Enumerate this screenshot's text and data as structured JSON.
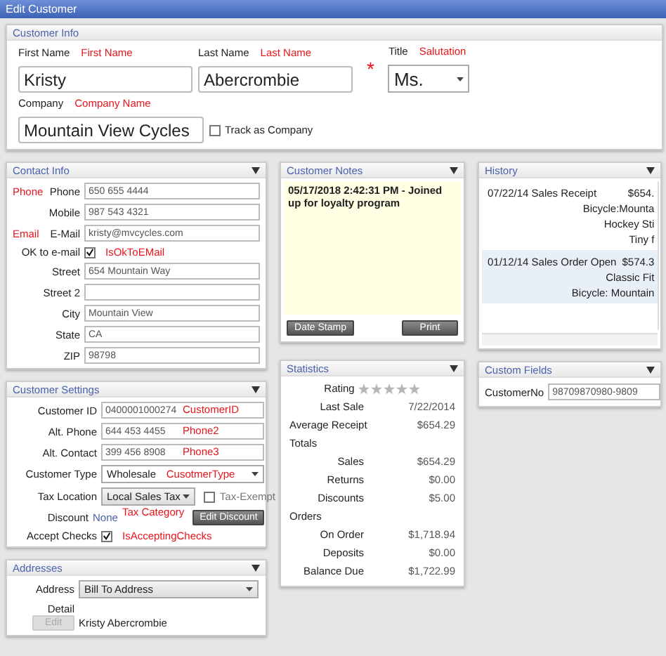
{
  "window": {
    "title": "Edit Customer"
  },
  "customer_info": {
    "title": "Customer Info",
    "first_name": {
      "label": "First Name",
      "annotation": "First Name",
      "value": "Kristy"
    },
    "last_name": {
      "label": "Last Name",
      "annotation": "Last Name",
      "value": "Abercrombie"
    },
    "required_mark": "*",
    "salutation": {
      "label": "Title",
      "annotation": "Salutation",
      "value": "Ms."
    },
    "company": {
      "label": "Company",
      "annotation": "Company Name",
      "value": "Mountain View Cycles"
    },
    "track_as_company": {
      "label": "Track as Company",
      "checked": false
    }
  },
  "contact_info": {
    "title": "Contact Info",
    "rows": [
      {
        "kind": "field",
        "label": "Phone",
        "annotation": "Phone",
        "value": "650 655 4444"
      },
      {
        "kind": "field",
        "label": "Mobile",
        "value": "987 543 4321"
      },
      {
        "kind": "field",
        "label": "E-Mail",
        "annotation": "Email",
        "value": "kristy@mvcycles.com"
      },
      {
        "kind": "checkbox",
        "label": "OK to e-mail",
        "annotation": "IsOkToEMail",
        "checked": true
      },
      {
        "kind": "field",
        "label": "Street",
        "value": "654 Mountain Way"
      },
      {
        "kind": "field",
        "label": "Street 2"
      },
      {
        "kind": "field",
        "label": "City",
        "value": "Mountain View"
      },
      {
        "kind": "field",
        "label": "State",
        "value": "CA"
      },
      {
        "kind": "field",
        "label": "ZIP",
        "value": "98798"
      }
    ]
  },
  "customer_settings": {
    "title": "Customer Settings",
    "customer_id": {
      "label": "Customer ID",
      "value": "0400001000274",
      "annotation": "CustomerID"
    },
    "alt_phone": {
      "label": "Alt. Phone",
      "value": "644 453 4455",
      "annotation": "Phone2"
    },
    "alt_contact": {
      "label": "Alt. Contact",
      "value": "399 456 8908",
      "annotation": "Phone3"
    },
    "customer_type": {
      "label": "Customer Type",
      "value": "Wholesale",
      "annotation": "CusotmerType"
    },
    "tax_location": {
      "label": "Tax Location",
      "value": "Local Sales Tax"
    },
    "tax_exempt": {
      "label": "Tax-Exempt",
      "checked": false
    },
    "discount": {
      "label": "Discount",
      "value": "None",
      "annotation": "Tax Category",
      "button": "Edit Discount"
    },
    "accept_checks": {
      "label": "Accept Checks",
      "checked": true,
      "annotation": "IsAcceptingChecks"
    }
  },
  "addresses": {
    "title": "Addresses",
    "address_label": "Address",
    "address_value": "Bill To Address",
    "detail_label": "Detail",
    "detail_value": "Kristy Abercrombie",
    "edit_button": {
      "label": "Edit",
      "disabled": true
    }
  },
  "customer_notes": {
    "title": "Customer Notes",
    "text": "05/17/2018 2:42:31 PM - Joined up for loyalty program",
    "buttons": [
      "Date Stamp",
      "Print"
    ]
  },
  "statistics": {
    "title": "Statistics",
    "rating": {
      "label": "Rating",
      "stars": 0
    },
    "rows": [
      {
        "kind": "row",
        "label": "Last Sale",
        "value": "7/22/2014"
      },
      {
        "kind": "row",
        "label": "Average Receipt",
        "value": "$654.29"
      },
      {
        "kind": "group",
        "label": "Totals"
      },
      {
        "kind": "row",
        "label": "Sales",
        "value": "$654.29"
      },
      {
        "kind": "row",
        "label": "Returns",
        "value": "$0.00"
      },
      {
        "kind": "row",
        "label": "Discounts",
        "value": "$5.00"
      },
      {
        "kind": "group",
        "label": "Orders"
      },
      {
        "kind": "row",
        "label": "On Order",
        "value": "$1,718.94"
      },
      {
        "kind": "row",
        "label": "Deposits",
        "value": "$0.00"
      },
      {
        "kind": "row",
        "label": "Balance Due",
        "value": "$1,722.99"
      }
    ]
  },
  "history": {
    "title": "History",
    "entries": [
      {
        "selected": false,
        "description": "07/22/14 Sales Receipt",
        "amount": "$654.",
        "items": [
          "Bicycle:Mounta",
          "Hockey Sti",
          "Tiny f"
        ]
      },
      {
        "selected": true,
        "description": "01/12/14 Sales Order Open",
        "amount": "$574.3",
        "items": [
          "Classic Fit",
          "Bicycle: Mountain"
        ]
      }
    ]
  },
  "custom_fields": {
    "title": "Custom Fields",
    "label": "CustomerNo",
    "value": "98709870980-9809"
  }
}
